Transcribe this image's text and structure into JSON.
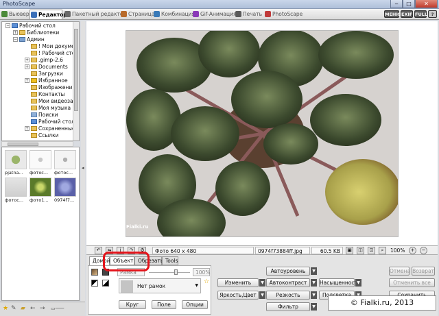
{
  "window": {
    "title": "PhotoScape"
  },
  "tabs": [
    {
      "label": "Вьювер",
      "color": "#4c8a3a"
    },
    {
      "label": "Редактор",
      "color": "#3a6fb8"
    },
    {
      "label": "Пакетный редактор",
      "color": "#6a6a6a"
    },
    {
      "label": "Страница",
      "color": "#b86a2a"
    },
    {
      "label": "Комбинация",
      "color": "#3a7ab8"
    },
    {
      "label": "Gif-Анимация",
      "color": "#8a3ab8"
    },
    {
      "label": "Печать",
      "color": "#5a5a5a"
    },
    {
      "label": "PhotoScape",
      "color": "#c03a3a"
    }
  ],
  "toolbar_buttons": [
    "МЕНЮ",
    "EXIF",
    "FULL"
  ],
  "tree": {
    "items": [
      {
        "label": "Рабочий стол",
        "level": 0,
        "exp": "−"
      },
      {
        "label": "Библиотеки",
        "level": 1,
        "exp": "+"
      },
      {
        "label": "Админ",
        "level": 1,
        "exp": "−"
      },
      {
        "label": "! Мои документы",
        "level": 2,
        "exp": ""
      },
      {
        "label": "! Рабочий стол",
        "level": 2,
        "exp": ""
      },
      {
        "label": ".gimp-2.6",
        "level": 2,
        "exp": "+"
      },
      {
        "label": "Documents",
        "level": 2,
        "exp": "+"
      },
      {
        "label": "Загрузки",
        "level": 2,
        "exp": ""
      },
      {
        "label": "Избранное",
        "level": 2,
        "exp": "+"
      },
      {
        "label": "Изображения",
        "level": 2,
        "exp": ""
      },
      {
        "label": "Контакты",
        "level": 2,
        "exp": ""
      },
      {
        "label": "Мои видеозаписи",
        "level": 2,
        "exp": ""
      },
      {
        "label": "Моя музыка",
        "level": 2,
        "exp": ""
      },
      {
        "label": "Поиски",
        "level": 2,
        "exp": ""
      },
      {
        "label": "Рабочий стол",
        "level": 2,
        "exp": ""
      },
      {
        "label": "Сохраненные и",
        "level": 2,
        "exp": "+"
      },
      {
        "label": "Ссылки",
        "level": 2,
        "exp": ""
      }
    ]
  },
  "thumbnails": [
    {
      "caption": "pjatna...",
      "color": "#7b9a4a"
    },
    {
      "caption": "фотос...",
      "color": "#f0f0f0"
    },
    {
      "caption": "фотос...",
      "color": "#ececec"
    },
    {
      "caption": "фотос...",
      "color": "#dcdcdc"
    },
    {
      "caption": "фото1...",
      "color": "#6d8a3a"
    },
    {
      "caption": "0974f7...",
      "color": "#6a6fb0"
    }
  ],
  "status": {
    "photo_size": "Фото 640 x 480",
    "filename": "0974f73884ff.jpg",
    "filesize": "60.5 KB",
    "zoom": "100%"
  },
  "photo": {
    "watermark": "Fialki.ru"
  },
  "editor": {
    "tabs": [
      "Домой",
      "Объект",
      "Обрезать",
      "Tools"
    ],
    "frame_field": "Рамка",
    "opacity_field": "100%",
    "frame_select": "Нет рамок",
    "buttons_left": [
      "Круг",
      "Поле",
      "Опции"
    ],
    "buttons_mid": [
      "Изменить",
      "Яркость,Цвет"
    ],
    "buttons_right1": [
      "Автоуровень",
      "Автоконтраст",
      "Резкость",
      "Фильтр"
    ],
    "buttons_right2": [
      "Насыщенность",
      "Подсветка"
    ],
    "buttons_far": [
      "Отмена",
      "Возврат",
      "Отменить все",
      "Сохранить"
    ]
  },
  "copyright": "© Fialki.ru, 2013"
}
